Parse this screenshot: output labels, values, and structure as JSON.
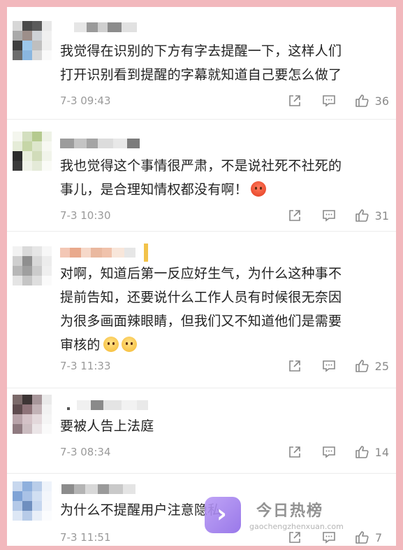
{
  "comments": [
    {
      "text_lines": [
        "我觉得在识别的下方有字去提醒一下，这样人们",
        "打开识别看到提醒的字幕就知道自己要怎么做了"
      ],
      "time": "7-3 09:43",
      "likes": "36"
    },
    {
      "text_lines": [
        "我也觉得这个事情很严肃，不是说社死不社死的",
        "事儿，是合理知情权都没有啊！"
      ],
      "time": "7-3 10:30",
      "likes": "31"
    },
    {
      "text_lines": [
        "对啊，知道后第一反应好生气，为什么这种事不",
        "提前告知，还要说什么工作人员有时候很无奈因",
        "为很多画面辣眼睛，但我们又不知道他们是需要",
        "审核的"
      ],
      "time": "7-3 11:33",
      "likes": "25"
    },
    {
      "text_lines": [
        "要被人告上法庭"
      ],
      "time": "7-3 08:34",
      "likes": "14"
    },
    {
      "text_lines": [
        "为什么不提醒用户注意隐私"
      ],
      "time": "7-3 11:51",
      "likes": "7"
    }
  ],
  "icons": {
    "share": "share-icon",
    "reply": "comment-icon",
    "like": "thumbs-up-icon"
  },
  "watermark": {
    "title": "今日热榜",
    "url": "gaochengzhenxuan.com"
  },
  "colors": {
    "background": "#f2b8bd",
    "text": "#222222",
    "meta": "#9a9a9a"
  }
}
